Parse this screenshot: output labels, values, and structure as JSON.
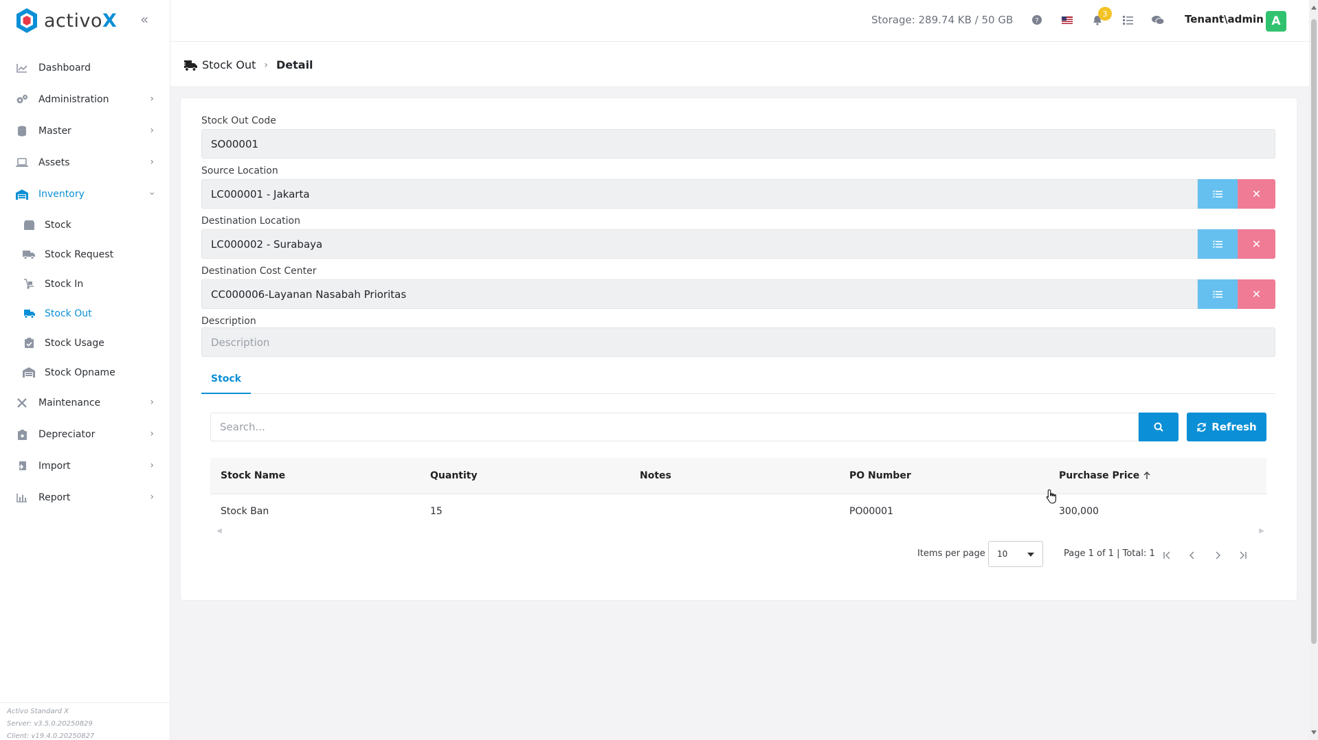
{
  "brand": {
    "name": "activo",
    "suffix": "X",
    "accent": "#0b8fd6",
    "logo_red": "#e8394a"
  },
  "header": {
    "storage": "Storage: 289.74 KB / 50 GB",
    "notification_count": "3",
    "user": "Tenant\\admin",
    "avatar_letter": "A",
    "icons": [
      "help-icon",
      "us-flag-icon",
      "bell-icon",
      "tasks-icon",
      "chat-icon"
    ]
  },
  "sidebar": {
    "items": [
      {
        "label": "Dashboard",
        "icon": "chart-line-icon"
      },
      {
        "label": "Administration",
        "icon": "cogs-icon"
      },
      {
        "label": "Master",
        "icon": "database-icon"
      },
      {
        "label": "Assets",
        "icon": "laptop-icon"
      },
      {
        "label": "Inventory",
        "icon": "warehouse-icon",
        "active": true
      },
      {
        "label": "Maintenance",
        "icon": "tools-icon"
      },
      {
        "label": "Depreciator",
        "icon": "clipboard-icon"
      },
      {
        "label": "Import",
        "icon": "import-icon"
      },
      {
        "label": "Report",
        "icon": "bar-chart-icon"
      }
    ],
    "inventory_sub": [
      {
        "label": "Stock",
        "icon": "box-icon"
      },
      {
        "label": "Stock Request",
        "icon": "truck-icon"
      },
      {
        "label": "Stock In",
        "icon": "dolly-icon"
      },
      {
        "label": "Stock Out",
        "icon": "truck-fast-icon",
        "active": true
      },
      {
        "label": "Stock Usage",
        "icon": "clipboard-check-icon"
      },
      {
        "label": "Stock Opname",
        "icon": "warehouse-icon"
      }
    ],
    "footer": {
      "product": "Activo Standard X",
      "server": "Server: v3.5.0.20250829",
      "client": "Client: v19.4.0.20250827"
    }
  },
  "breadcrumb": {
    "parent": "Stock Out",
    "current": "Detail"
  },
  "form": {
    "stock_out_code": {
      "label": "Stock Out Code",
      "value": "SO00001"
    },
    "source_location": {
      "label": "Source Location",
      "value": "LC000001 - Jakarta"
    },
    "destination_location": {
      "label": "Destination Location",
      "value": "LC000002 - Surabaya"
    },
    "destination_cost_center": {
      "label": "Destination Cost Center",
      "value": "CC000006-Layanan Nasabah Prioritas"
    },
    "description": {
      "label": "Description",
      "placeholder": "Description"
    }
  },
  "tabs": [
    {
      "label": "Stock",
      "active": true
    }
  ],
  "table": {
    "search_placeholder": "Search...",
    "refresh_label": "Refresh",
    "columns": [
      "Stock Name",
      "Quantity",
      "Notes",
      "PO Number",
      "Purchase Price"
    ],
    "sorted_column": "Purchase Price",
    "rows": [
      [
        "Stock Ban",
        "15",
        "",
        "PO00001",
        "300,000"
      ]
    ]
  },
  "pagination": {
    "items_per_page_label": "Items per page",
    "items_per_page": "10",
    "summary": "Page 1 of 1 | Total: 1"
  }
}
